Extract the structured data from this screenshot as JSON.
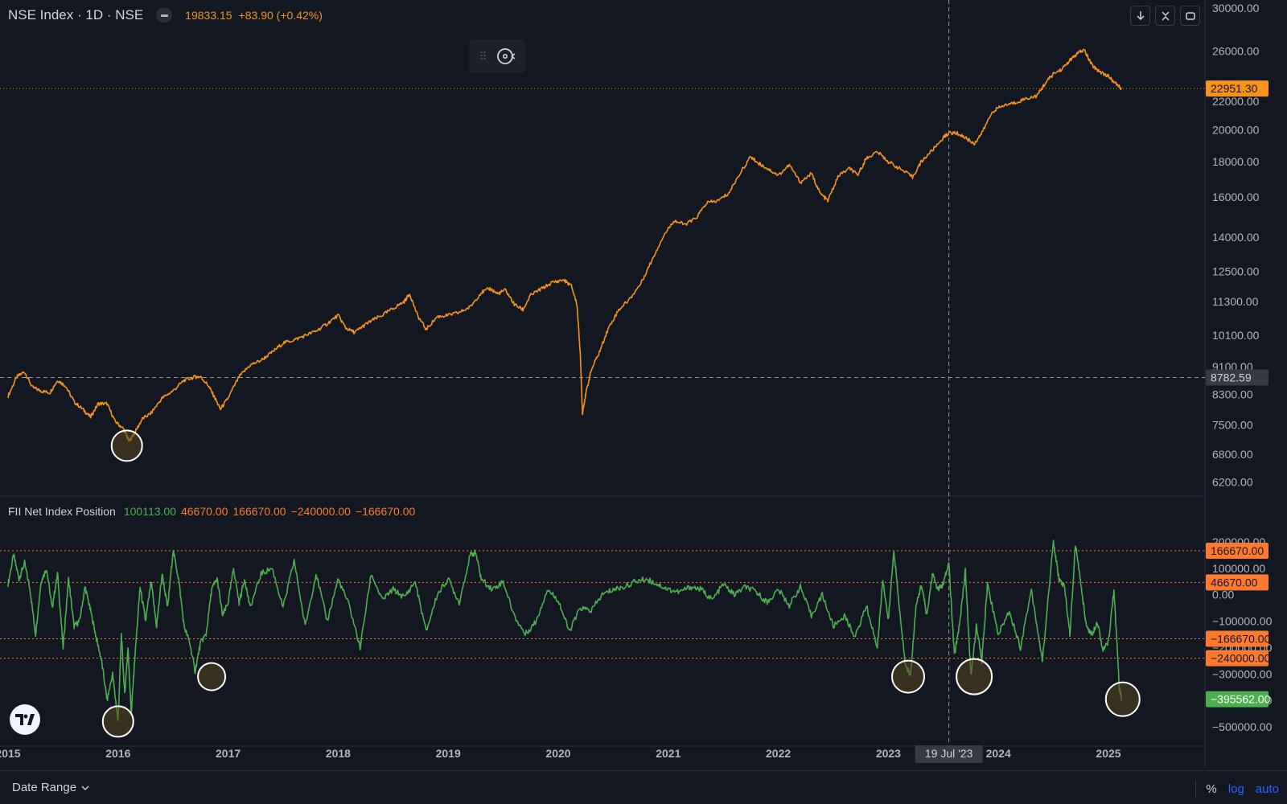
{
  "header": {
    "title": "NSE Index · 1D · NSE",
    "ohlc_text": "19833.15",
    "change_text": "+83.90 (+0.42%)"
  },
  "indicator": {
    "title": "FII Net Index Position",
    "values": [
      {
        "text": "100113.00",
        "color": "#4caf50"
      },
      {
        "text": "46670.00",
        "color": "#ff7a2e"
      },
      {
        "text": "166670.00",
        "color": "#ff7a2e"
      },
      {
        "text": "−240000.00",
        "color": "#ff7a2e"
      },
      {
        "text": "−166670.00",
        "color": "#ff7a2e"
      }
    ]
  },
  "toolbar": {
    "icons": [
      "download-icon",
      "collapse-icon",
      "maximize-icon"
    ]
  },
  "bottom_bar": {
    "date_range_label": "Date Range",
    "percent_label": "%",
    "log_label": "log",
    "auto_label": "auto"
  },
  "colors": {
    "background": "#131722",
    "price_line": "#f7931a",
    "indicator_line": "#4caf50",
    "threshold_line": "#ff7a2e",
    "price_badge": "#f7931a",
    "indicator_badge": "#4caf50",
    "crosshair_label_bg": "#363a45",
    "link": "#2962ff"
  },
  "chart_data": [
    {
      "type": "line",
      "title": "NSE Index · 1D · NSE",
      "scale": "log",
      "ylim": [
        6000,
        30000
      ],
      "y_ticks": [
        "30000.00",
        "26000.00",
        "22000.00",
        "20000.00",
        "18000.00",
        "16000.00",
        "14000.00",
        "12500.00",
        "11300.00",
        "10100.00",
        "9100.00",
        "8300.00",
        "7500.00",
        "6800.00",
        "6200.00"
      ],
      "x_ticks": [
        "2015",
        "2016",
        "2017",
        "2018",
        "2019",
        "2020",
        "2021",
        "2022",
        "2023",
        "2024",
        "2025"
      ],
      "xlim": [
        2015.0,
        2025.85
      ],
      "series": [
        {
          "x": [
            2015.0,
            2015.08,
            2015.15,
            2015.22,
            2015.3,
            2015.38,
            2015.45,
            2015.52,
            2015.6,
            2015.68,
            2015.75,
            2015.82,
            2015.9,
            2015.97,
            2016.05,
            2016.1,
            2016.15,
            2016.22,
            2016.3,
            2016.4,
            2016.5,
            2016.6,
            2016.7,
            2016.75,
            2016.82,
            2016.88,
            2016.93,
            2017.0,
            2017.1,
            2017.2,
            2017.3,
            2017.4,
            2017.5,
            2017.6,
            2017.7,
            2017.8,
            2017.9,
            2018.0,
            2018.07,
            2018.15,
            2018.22,
            2018.3,
            2018.4,
            2018.5,
            2018.6,
            2018.65,
            2018.72,
            2018.8,
            2018.9,
            2019.0,
            2019.1,
            2019.2,
            2019.3,
            2019.38,
            2019.45,
            2019.52,
            2019.6,
            2019.68,
            2019.75,
            2019.85,
            2019.95,
            2020.05,
            2020.12,
            2020.17,
            2020.2,
            2020.22,
            2020.25,
            2020.3,
            2020.38,
            2020.45,
            2020.55,
            2020.65,
            2020.75,
            2020.85,
            2020.95,
            2021.05,
            2021.15,
            2021.25,
            2021.35,
            2021.45,
            2021.55,
            2021.65,
            2021.75,
            2021.8,
            2021.9,
            2022.0,
            2022.1,
            2022.2,
            2022.3,
            2022.38,
            2022.45,
            2022.55,
            2022.65,
            2022.72,
            2022.8,
            2022.9,
            2023.0,
            2023.1,
            2023.22,
            2023.3,
            2023.4,
            2023.5,
            2023.55,
            2023.62,
            2023.7,
            2023.78,
            2023.85,
            2023.95,
            2024.05,
            2024.15,
            2024.25,
            2024.35,
            2024.42,
            2024.5,
            2024.58,
            2024.65,
            2024.72,
            2024.78,
            2024.85,
            2024.92,
            2025.0,
            2025.07,
            2025.12
          ],
          "values": [
            8250,
            8800,
            8950,
            8500,
            8400,
            8350,
            8700,
            8550,
            8100,
            7900,
            7700,
            8050,
            8050,
            7600,
            7400,
            7100,
            7300,
            7650,
            7800,
            8200,
            8400,
            8700,
            8800,
            8800,
            8550,
            8200,
            7900,
            8200,
            8800,
            9150,
            9300,
            9550,
            9850,
            9950,
            10100,
            10250,
            10500,
            10800,
            10350,
            10200,
            10400,
            10600,
            10800,
            11050,
            11300,
            11600,
            10800,
            10300,
            10750,
            10800,
            10900,
            11100,
            11650,
            11800,
            11600,
            11750,
            11200,
            11000,
            11550,
            11800,
            12050,
            12150,
            11900,
            11200,
            9500,
            7800,
            8300,
            9000,
            9600,
            10300,
            11000,
            11400,
            12000,
            12950,
            14000,
            14800,
            14600,
            14900,
            15700,
            15800,
            16200,
            17300,
            18300,
            18000,
            17600,
            17200,
            17800,
            16800,
            17300,
            16200,
            15800,
            17200,
            17600,
            17200,
            18200,
            18600,
            18000,
            17600,
            17100,
            18000,
            18700,
            19500,
            19800,
            19800,
            19500,
            19100,
            19800,
            21300,
            21700,
            21900,
            22200,
            22400,
            23300,
            24100,
            24500,
            25200,
            25800,
            26100,
            24800,
            24300,
            23900,
            23300,
            22950
          ]
        }
      ],
      "price_labels": [
        {
          "text": "22951.30",
          "value": 22951.3,
          "kind": "last-price"
        },
        {
          "text": "8782.59",
          "value": 8782.59,
          "kind": "crosshair"
        }
      ],
      "annotations": [
        "circle at 2016 low"
      ]
    },
    {
      "type": "line",
      "title": "FII Net Index Position",
      "ylim": [
        -520000,
        220000
      ],
      "y_ticks": [
        "200000.00",
        "100000.00",
        "0.00",
        "−100000.00",
        "−200000.00",
        "−300000.00",
        "−400000.00",
        "−500000.00"
      ],
      "thresholds": [
        {
          "text": "166670.00",
          "value": 166670
        },
        {
          "text": "46670.00",
          "value": 46670
        },
        {
          "text": "−166670.00",
          "value": -166670
        },
        {
          "text": "−240000.00",
          "value": -240000
        }
      ],
      "series": [
        {
          "name": "FII Net Index Position",
          "x": [
            2015.0,
            2015.05,
            2015.1,
            2015.15,
            2015.2,
            2015.25,
            2015.3,
            2015.35,
            2015.4,
            2015.45,
            2015.5,
            2015.55,
            2015.6,
            2015.65,
            2015.7,
            2015.75,
            2015.8,
            2015.85,
            2015.9,
            2015.95,
            2016.0,
            2016.03,
            2016.06,
            2016.09,
            2016.12,
            2016.15,
            2016.2,
            2016.25,
            2016.3,
            2016.35,
            2016.4,
            2016.45,
            2016.5,
            2016.55,
            2016.6,
            2016.65,
            2016.7,
            2016.75,
            2016.8,
            2016.85,
            2016.9,
            2016.95,
            2017.0,
            2017.05,
            2017.1,
            2017.15,
            2017.2,
            2017.3,
            2017.4,
            2017.5,
            2017.6,
            2017.7,
            2017.8,
            2017.9,
            2018.0,
            2018.1,
            2018.2,
            2018.3,
            2018.4,
            2018.5,
            2018.6,
            2018.7,
            2018.8,
            2018.9,
            2019.0,
            2019.1,
            2019.2,
            2019.25,
            2019.3,
            2019.4,
            2019.5,
            2019.6,
            2019.7,
            2019.8,
            2019.9,
            2020.0,
            2020.1,
            2020.2,
            2020.3,
            2020.4,
            2020.5,
            2020.6,
            2020.7,
            2020.8,
            2020.9,
            2021.0,
            2021.1,
            2021.2,
            2021.3,
            2021.4,
            2021.5,
            2021.6,
            2021.7,
            2021.8,
            2021.9,
            2022.0,
            2022.1,
            2022.2,
            2022.3,
            2022.4,
            2022.5,
            2022.6,
            2022.7,
            2022.8,
            2022.9,
            2022.95,
            2023.0,
            2023.05,
            2023.1,
            2023.15,
            2023.2,
            2023.25,
            2023.3,
            2023.35,
            2023.4,
            2023.45,
            2023.5,
            2023.55,
            2023.6,
            2023.65,
            2023.7,
            2023.75,
            2023.8,
            2023.85,
            2023.9,
            2024.0,
            2024.1,
            2024.2,
            2024.3,
            2024.4,
            2024.5,
            2024.55,
            2024.6,
            2024.65,
            2024.7,
            2024.75,
            2024.8,
            2024.85,
            2024.9,
            2024.95,
            2025.0,
            2025.05,
            2025.1,
            2025.12
          ],
          "values": [
            40000,
            150000,
            60000,
            120000,
            20000,
            -150000,
            50000,
            100000,
            -50000,
            80000,
            -200000,
            60000,
            -120000,
            -100000,
            30000,
            -60000,
            -160000,
            -250000,
            -400000,
            -300000,
            -480000,
            -150000,
            -380000,
            -200000,
            -450000,
            -250000,
            30000,
            -100000,
            50000,
            -120000,
            80000,
            -50000,
            170000,
            60000,
            -120000,
            -180000,
            -290000,
            -180000,
            -150000,
            20000,
            60000,
            -80000,
            -30000,
            100000,
            -30000,
            60000,
            -50000,
            80000,
            100000,
            -50000,
            130000,
            -120000,
            80000,
            -100000,
            60000,
            -40000,
            -200000,
            80000,
            -20000,
            20000,
            -10000,
            50000,
            -140000,
            0,
            60000,
            -30000,
            150000,
            160000,
            60000,
            20000,
            50000,
            -80000,
            -150000,
            -100000,
            20000,
            -20000,
            -140000,
            -50000,
            -60000,
            0,
            20000,
            30000,
            50000,
            60000,
            40000,
            20000,
            10000,
            30000,
            20000,
            -20000,
            40000,
            0,
            30000,
            10000,
            -30000,
            20000,
            -40000,
            30000,
            -80000,
            0,
            -120000,
            -80000,
            -160000,
            -40000,
            -200000,
            60000,
            -100000,
            170000,
            -50000,
            -250000,
            -310000,
            -50000,
            40000,
            -80000,
            80000,
            20000,
            40000,
            120000,
            -230000,
            -100000,
            90000,
            -310000,
            -120000,
            -250000,
            40000,
            -150000,
            -60000,
            -200000,
            20000,
            -250000,
            200000,
            60000,
            30000,
            -150000,
            190000,
            40000,
            -120000,
            -150000,
            -100000,
            -210000,
            -180000,
            20000,
            -360000,
            -395562
          ]
        }
      ],
      "value_labels": [
        {
          "text": "−395562.00",
          "value": -395562,
          "kind": "last-value"
        }
      ],
      "annotations": [
        "circles at 2016 low",
        "circle at late 2016",
        "circle at 2023",
        "circle at late 2023",
        "circle at 2025"
      ]
    }
  ],
  "x_axis": {
    "labels": [
      "2015",
      "2016",
      "2017",
      "2018",
      "2019",
      "2020",
      "2021",
      "2022",
      "2023",
      "2024",
      "2025"
    ],
    "crosshair_label": "19 Jul '23"
  }
}
